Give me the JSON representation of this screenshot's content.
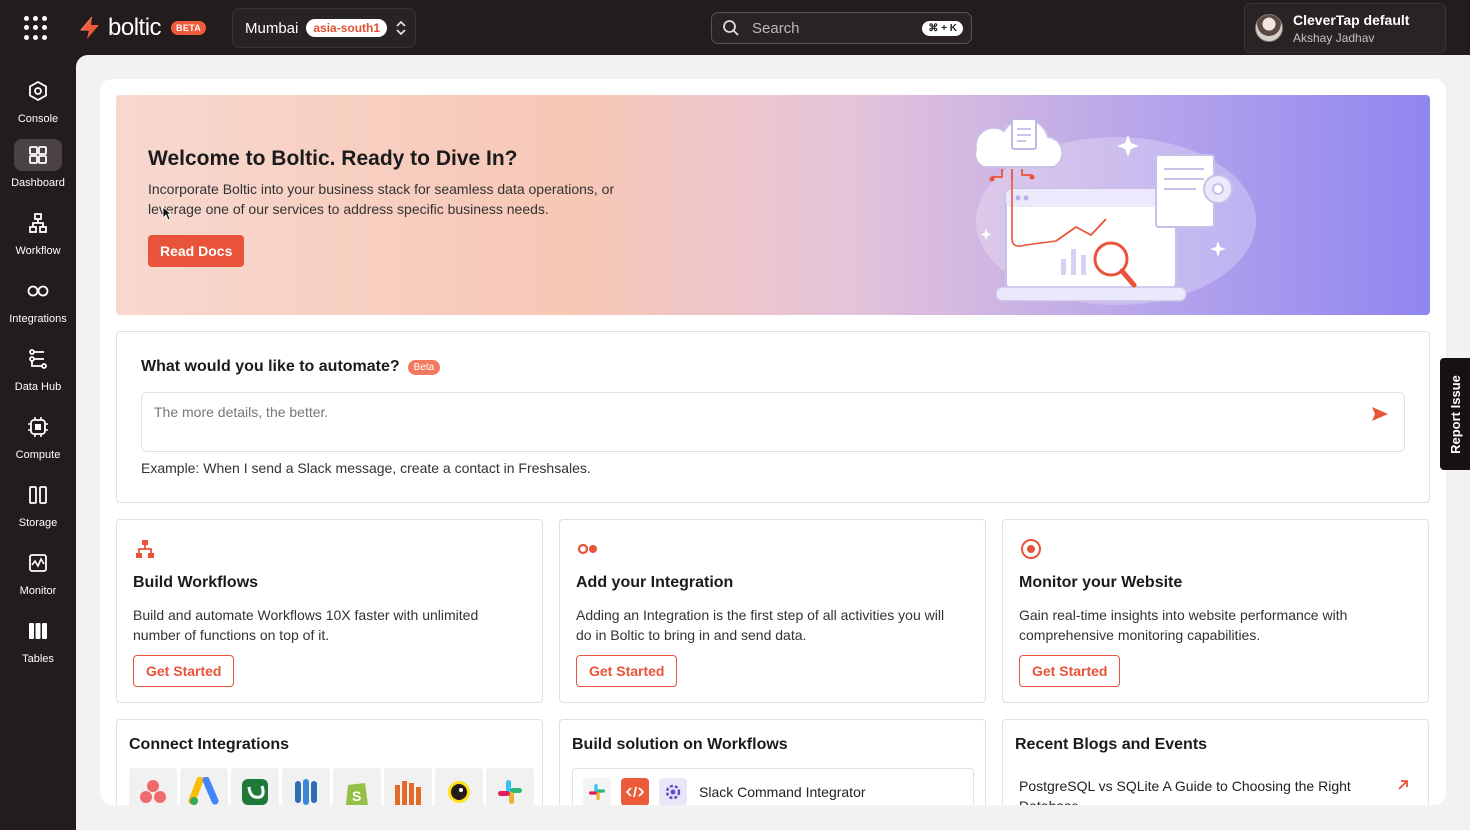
{
  "topbar": {
    "brand": "boltic",
    "brand_badge": "BETA",
    "region_name": "Mumbai",
    "region_code": "asia-south1",
    "search_placeholder": "Search",
    "search_shortcut": "⌘ + K",
    "account_name": "CleverTap default",
    "account_user": "Akshay Jadhav"
  },
  "sidebar": {
    "items": [
      {
        "label": "Console",
        "icon": "console-icon"
      },
      {
        "label": "Dashboard",
        "icon": "dashboard-icon",
        "active": true
      },
      {
        "label": "Workflow",
        "icon": "workflow-icon"
      },
      {
        "label": "Integrations",
        "icon": "integrations-icon"
      },
      {
        "label": "Data Hub",
        "icon": "data-hub-icon"
      },
      {
        "label": "Compute",
        "icon": "compute-icon"
      },
      {
        "label": "Storage",
        "icon": "storage-icon"
      },
      {
        "label": "Monitor",
        "icon": "monitor-icon"
      },
      {
        "label": "Tables",
        "icon": "tables-icon"
      }
    ]
  },
  "hero": {
    "title": "Welcome to Boltic. Ready to Dive In?",
    "description": "Incorporate Boltic into your business stack for seamless data operations, or leverage one of our services to address specific business needs.",
    "button": "Read Docs"
  },
  "automate": {
    "title": "What would you like to automate?",
    "badge": "Beta",
    "placeholder": "The more details, the better.",
    "example": "Example: When I send a Slack message, create a contact in Freshsales."
  },
  "cards": [
    {
      "title": "Build Workflows",
      "description": "Build and automate Workflows 10X faster with unlimited number of functions on top of it.",
      "button": "Get Started",
      "icon": "workflow-icon"
    },
    {
      "title": "Add your Integration",
      "description": "Adding an Integration is the first step of all activities you will do in Boltic to bring in and send data.",
      "button": "Get Started",
      "icon": "integration-icon"
    },
    {
      "title": "Monitor your Website",
      "description": "Gain real-time insights into website performance with comprehensive monitoring capabilities.",
      "button": "Get Started",
      "icon": "monitor-icon"
    }
  ],
  "bottom": {
    "integrations_title": "Connect Integrations",
    "integration_logos": [
      "asana-logo",
      "google-ads-logo",
      "freshworks-logo",
      "database-logo",
      "shopify-logo",
      "aws-logo",
      "mailchimp-logo",
      "slack-logo"
    ],
    "workflows_title": "Build solution on Workflows",
    "solution_label": "Slack Command Integrator",
    "blogs_title": "Recent Blogs and Events",
    "blog_item": "PostgreSQL vs SQLite A Guide to Choosing the Right Database"
  },
  "report_issue": "Report Issue",
  "colors": {
    "accent": "#e9533a",
    "sidebar_bg": "#221c1d"
  }
}
